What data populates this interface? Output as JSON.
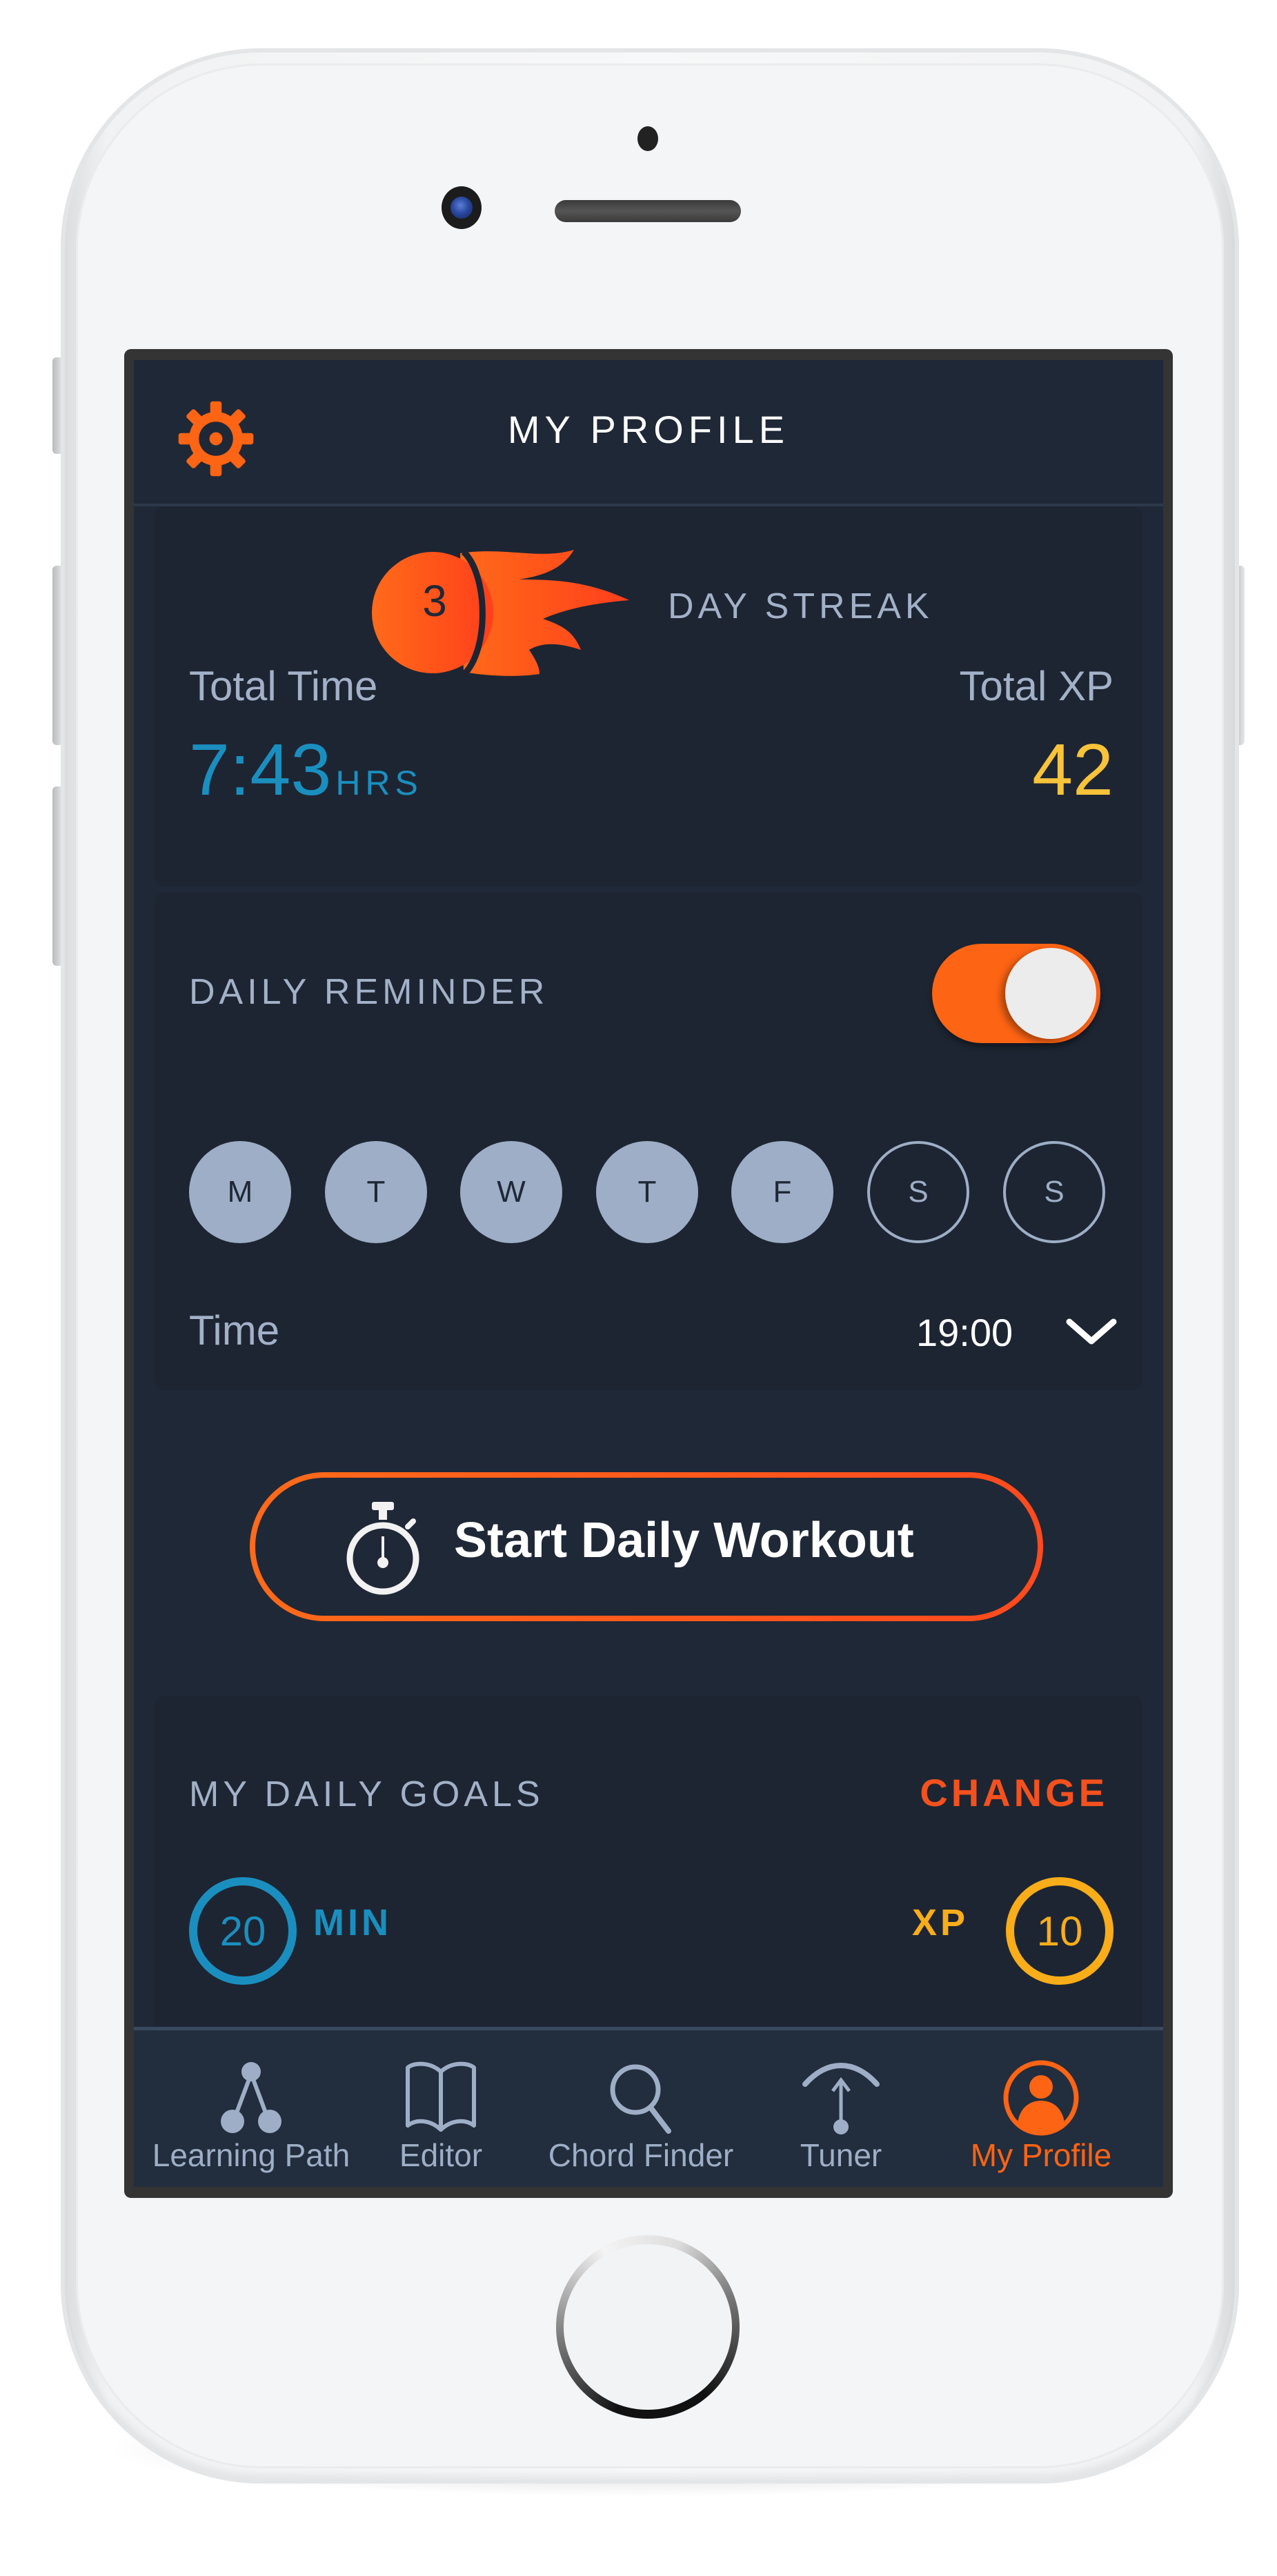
{
  "header": {
    "title": "MY PROFILE",
    "settings_icon": "gear-icon"
  },
  "streak": {
    "count": "3",
    "label": "DAY STREAK",
    "icon": "fire-streak-icon"
  },
  "stats": {
    "total_time_label": "Total Time",
    "total_time_value": "7:43",
    "total_time_unit": "HRS",
    "total_xp_label": "Total XP",
    "total_xp_value": "42"
  },
  "reminder": {
    "label": "DAILY REMINDER",
    "enabled": true,
    "days": [
      {
        "label": "M",
        "selected": true
      },
      {
        "label": "T",
        "selected": true
      },
      {
        "label": "W",
        "selected": true
      },
      {
        "label": "T",
        "selected": true
      },
      {
        "label": "F",
        "selected": true
      },
      {
        "label": "S",
        "selected": false
      },
      {
        "label": "S",
        "selected": false
      }
    ],
    "time_label": "Time",
    "time_value": "19:00"
  },
  "workout": {
    "label": "Start Daily Workout",
    "icon": "stopwatch-icon"
  },
  "goals": {
    "label": "MY DAILY GOALS",
    "change_label": "CHANGE",
    "minutes_value": "20",
    "minutes_unit": "MIN",
    "xp_unit": "XP",
    "xp_value": "10"
  },
  "tabs": [
    {
      "label": "Learning Path",
      "icon": "learning-path-icon",
      "active": false
    },
    {
      "label": "Editor",
      "icon": "book-icon",
      "active": false
    },
    {
      "label": "Chord Finder",
      "icon": "search-icon",
      "active": false
    },
    {
      "label": "Tuner",
      "icon": "tuner-icon",
      "active": false
    },
    {
      "label": "My Profile",
      "icon": "profile-icon",
      "active": true
    }
  ],
  "colors": {
    "accent": "#fd6414",
    "time_blue": "#1a8fbf",
    "xp_yellow": "#f7c33a",
    "goal_xp_orange": "#f9ad19",
    "muted": "#a3b1c8",
    "background": "#1f2836"
  }
}
